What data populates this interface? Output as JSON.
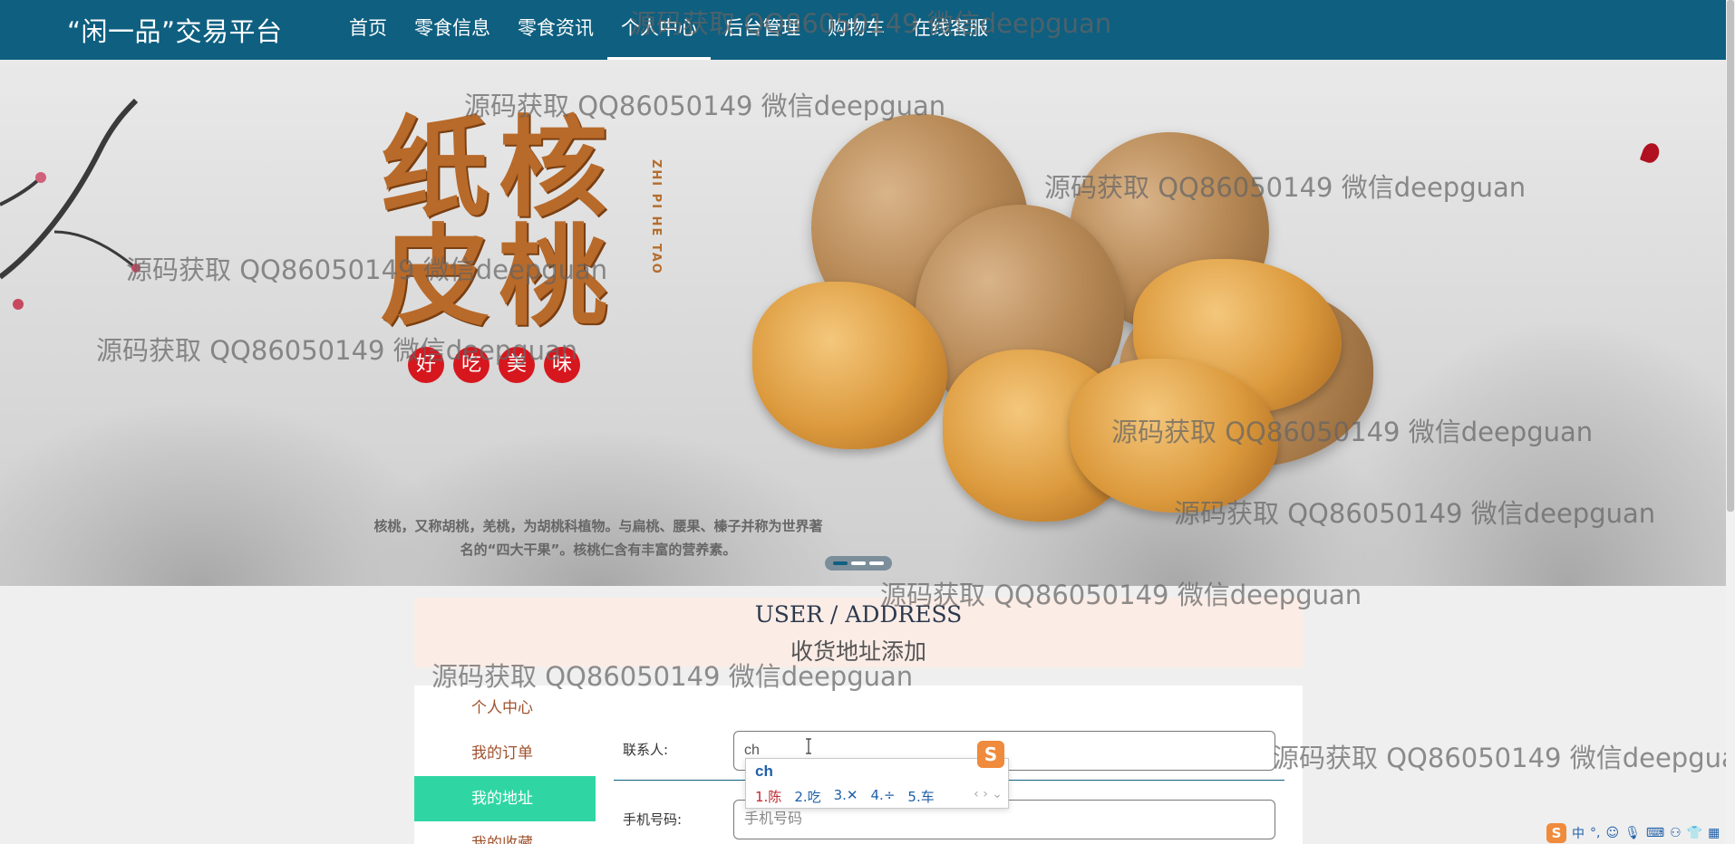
{
  "header": {
    "brand": "“闲一品”交易平台",
    "nav": [
      {
        "label": "首页",
        "active": false
      },
      {
        "label": "零食信息",
        "active": false
      },
      {
        "label": "零食资讯",
        "active": false
      },
      {
        "label": "个人中心",
        "active": true
      },
      {
        "label": "后台管理",
        "active": false
      },
      {
        "label": "购物车",
        "active": false
      },
      {
        "label": "在线客服",
        "active": false
      }
    ]
  },
  "banner": {
    "title_chars": [
      "纸",
      "核",
      "皮",
      "桃"
    ],
    "vertical_text": "ZHI PI HE TAO",
    "pills": [
      "好",
      "吃",
      "美",
      "味"
    ],
    "description": "核桃，又称胡桃，羌桃，为胡桃科植物。与扁桃、腰果、榛子并称为世界著名的“四大干果”。核桃仁含有丰富的营养素。",
    "carousel": {
      "count": 3,
      "active_index": 0
    }
  },
  "section": {
    "title_en": "USER / ADDRESS",
    "title_cn": "收货地址添加"
  },
  "sidebar": {
    "items": [
      {
        "label": "个人中心",
        "active": false
      },
      {
        "label": "我的订单",
        "active": false
      },
      {
        "label": "我的地址",
        "active": true
      },
      {
        "label": "我的收藏",
        "active": false
      }
    ]
  },
  "form": {
    "contact_label": "联系人:",
    "contact_value": "ch",
    "phone_label": "手机号码:",
    "phone_placeholder": "手机号码"
  },
  "ime": {
    "pinyin": "ch",
    "candidates": [
      "1.陈",
      "2.吃",
      "3.✕",
      "4.÷",
      "5.车"
    ],
    "logo": "S"
  },
  "ime_status": {
    "logo": "S",
    "mode": "中"
  },
  "watermark": {
    "text": "源码获取 QQ86050149 微信deepguan"
  },
  "colors": {
    "header_bg": "#0e5f80",
    "sidebar_active": "#2fd6a4",
    "section_bg": "#fbece6",
    "link": "#a0522d"
  }
}
